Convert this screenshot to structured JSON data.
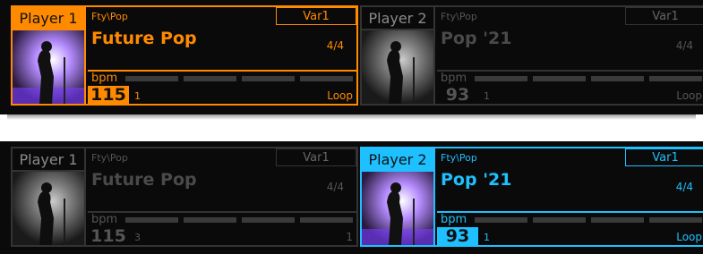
{
  "players": [
    {
      "id": "p1-top",
      "label": "Player 1",
      "category": "Fty\\Pop",
      "variation": "Var1",
      "name": "Future Pop",
      "signature": "4/4",
      "bpm_label": "bpm",
      "tempo": "115",
      "measure": "1",
      "mode": "Loop",
      "state": "active-orange"
    },
    {
      "id": "p2-top",
      "label": "Player 2",
      "category": "Fty\\Pop",
      "variation": "Var1",
      "name": "Pop '21",
      "signature": "4/4",
      "bpm_label": "bpm",
      "tempo": "93",
      "measure": "1",
      "mode": "Loop",
      "state": "inactive"
    },
    {
      "id": "p1-bottom",
      "label": "Player 1",
      "category": "Fty\\Pop",
      "variation": "Var1",
      "name": "Future Pop",
      "signature": "4/4",
      "bpm_label": "bpm",
      "tempo": "115",
      "measure": "3",
      "mode": "1",
      "state": "inactive"
    },
    {
      "id": "p2-bottom",
      "label": "Player 2",
      "category": "Fty\\Pop",
      "variation": "Var1",
      "name": "Pop '21",
      "signature": "4/4",
      "bpm_label": "bpm",
      "tempo": "93",
      "measure": "1",
      "mode": "Loop",
      "state": "active-blue"
    }
  ],
  "colors": {
    "orange": "#ff8a00",
    "blue": "#1ec0ff",
    "background": "#0a0a0a"
  }
}
